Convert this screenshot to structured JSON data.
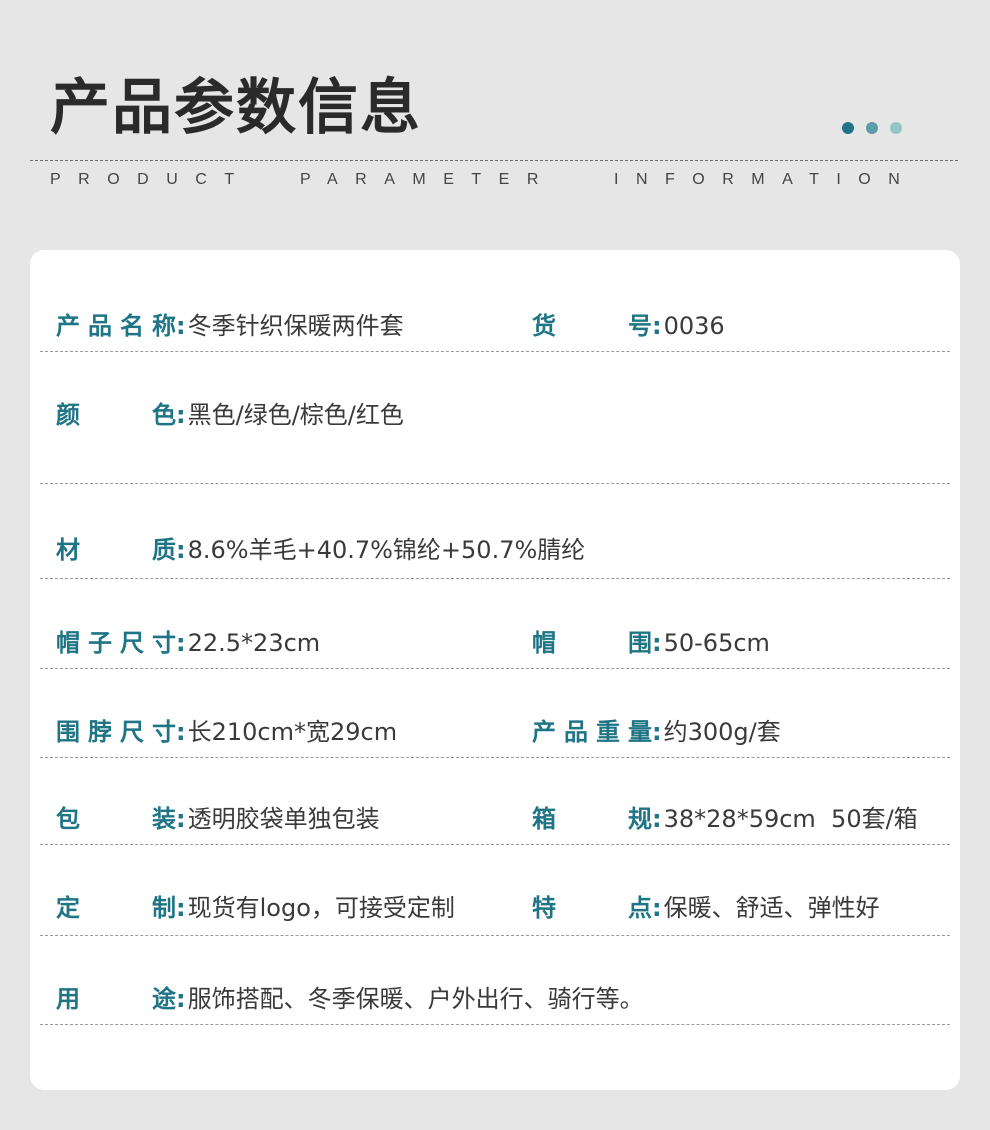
{
  "header": {
    "title": "产品参数信息",
    "subtitle_words": [
      "PRODUCT",
      "PARAMETER",
      "INFORMATION"
    ],
    "dot_colors": [
      "#1f7585",
      "#5a9ea8",
      "#94c3c8"
    ]
  },
  "colors": {
    "background": "#e5e6e5",
    "card": "#ffffff",
    "label": "#1f7585",
    "value": "#3a3a3a"
  },
  "rows": [
    {
      "fields": [
        {
          "label": "产品名称",
          "value": "冬季针织保暖两件套"
        },
        {
          "label": "货号",
          "value": "0036"
        }
      ]
    },
    {
      "fields": [
        {
          "label": "颜色",
          "value": "黑色/绿色/棕色/红色"
        }
      ]
    },
    {
      "fields": [
        {
          "label": "材质",
          "value": "8.6%羊毛+40.7%锦纶+50.7%腈纶"
        }
      ]
    },
    {
      "fields": [
        {
          "label": "帽子尺寸",
          "value": "22.5*23cm"
        },
        {
          "label": "帽围",
          "value": "50-65cm"
        }
      ]
    },
    {
      "fields": [
        {
          "label": "围脖尺寸",
          "value": "长210cm*宽29cm"
        },
        {
          "label": "产品重量",
          "value": "约300g/套"
        }
      ]
    },
    {
      "fields": [
        {
          "label": "包装",
          "value": "透明胶袋单独包装"
        },
        {
          "label": "箱规",
          "value": "38*28*59cm  50套/箱"
        }
      ]
    },
    {
      "fields": [
        {
          "label": "定制",
          "value": "现货有logo，可接受定制"
        },
        {
          "label": "特点",
          "value": "保暖、舒适、弹性好"
        }
      ]
    },
    {
      "fields": [
        {
          "label": "用途",
          "value": "服饰搭配、冬季保暖、户外出行、骑行等。"
        }
      ]
    }
  ]
}
